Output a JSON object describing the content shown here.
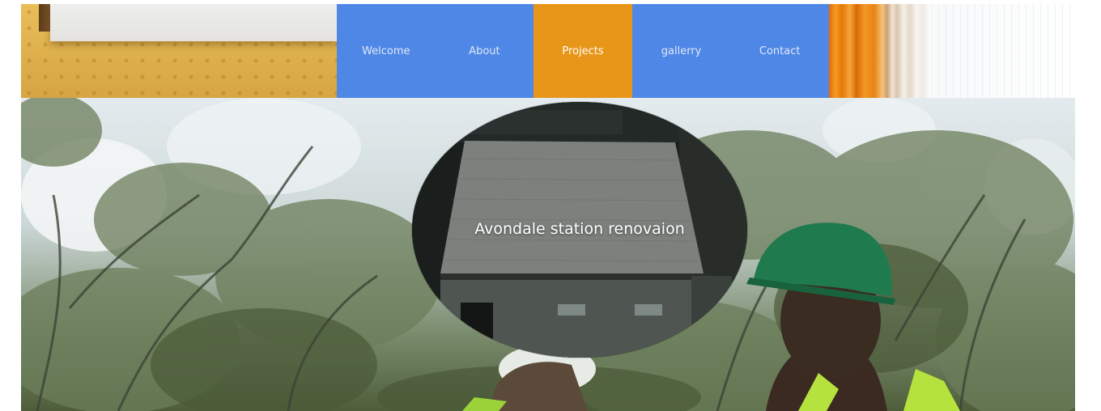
{
  "nav": {
    "items": [
      {
        "label": "Welcome"
      },
      {
        "label": "About"
      },
      {
        "label": "Projects"
      },
      {
        "label": "gallerry"
      },
      {
        "label": "Contact"
      }
    ],
    "active_index": 2
  },
  "hero": {
    "project_title": "Avondale station renovaion"
  },
  "colors": {
    "nav_background": "#4f87e6",
    "nav_active": "#e8961a",
    "nav_text": "#dfe8f8"
  }
}
